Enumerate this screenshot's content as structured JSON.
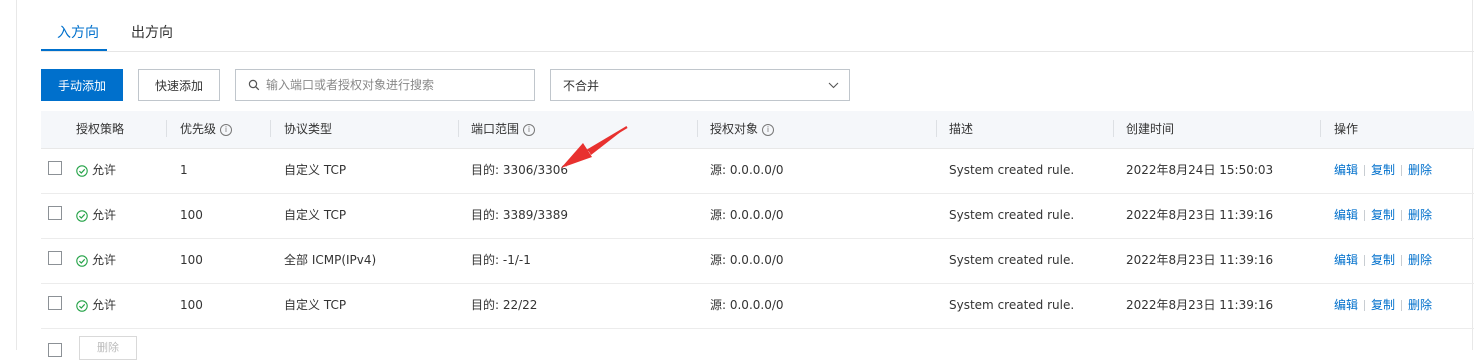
{
  "tabs": [
    {
      "label": "入方向",
      "active": true
    },
    {
      "label": "出方向",
      "active": false
    }
  ],
  "toolbar": {
    "manual_add": "手动添加",
    "quick_add": "快速添加",
    "search_placeholder": "输入端口或者授权对象进行搜索",
    "merge_select": "不合并"
  },
  "table": {
    "headers": {
      "policy": "授权策略",
      "priority": "优先级",
      "protocol": "协议类型",
      "port_range": "端口范围",
      "auth_object": "授权对象",
      "description": "描述",
      "created": "创建时间",
      "actions": "操作"
    },
    "info_glyph": "i",
    "rows": [
      {
        "policy": "允许",
        "priority": "1",
        "protocol": "自定义 TCP",
        "port": "目的: 3306/3306",
        "source": "源: 0.0.0.0/0",
        "description": "System created rule.",
        "created": "2022年8月24日 15:50:03"
      },
      {
        "policy": "允许",
        "priority": "100",
        "protocol": "自定义 TCP",
        "port": "目的: 3389/3389",
        "source": "源: 0.0.0.0/0",
        "description": "System created rule.",
        "created": "2022年8月23日 11:39:16"
      },
      {
        "policy": "允许",
        "priority": "100",
        "protocol": "全部 ICMP(IPv4)",
        "port": "目的: -1/-1",
        "source": "源: 0.0.0.0/0",
        "description": "System created rule.",
        "created": "2022年8月23日 11:39:16"
      },
      {
        "policy": "允许",
        "priority": "100",
        "protocol": "自定义 TCP",
        "port": "目的: 22/22",
        "source": "源: 0.0.0.0/0",
        "description": "System created rule.",
        "created": "2022年8月23日 11:39:16"
      }
    ],
    "actions": {
      "edit": "编辑",
      "copy": "复制",
      "delete": "删除"
    }
  },
  "footer": {
    "batch_delete": "删除"
  },
  "colors": {
    "primary": "#0070cc",
    "success": "#25a348",
    "arrow": "#e8312f"
  }
}
